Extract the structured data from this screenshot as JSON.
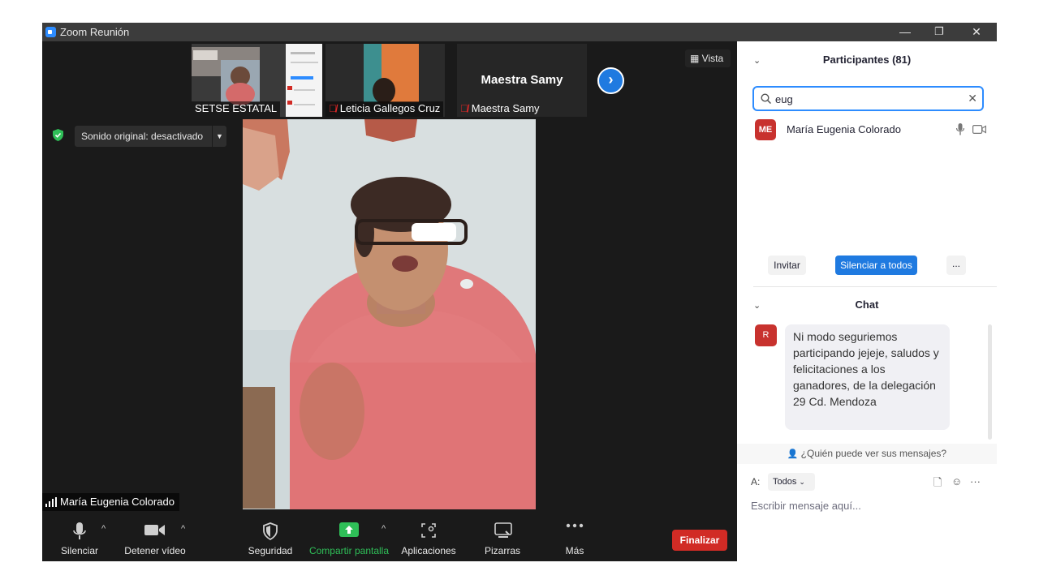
{
  "window": {
    "title": "Zoom Reunión",
    "minimize": "—",
    "restore": "❐",
    "close": "✕"
  },
  "thumbnails": [
    {
      "name": "SETSE ESTATAL",
      "muted": false
    },
    {
      "name": "Leticia Gallegos Cruz",
      "muted": true
    },
    {
      "name": "Maestra Samy",
      "muted": true,
      "display_name": "Maestra Samy"
    }
  ],
  "view_button": "Vista",
  "original_sound": "Sonido original: desactivado",
  "active_speaker": "María Eugenia Colorado",
  "toolbar": {
    "mute": "Silenciar",
    "stop_video": "Detener vídeo",
    "security": "Seguridad",
    "share_screen": "Compartir pantalla",
    "apps": "Aplicaciones",
    "whiteboards": "Pizarras",
    "more": "Más",
    "end": "Finalizar"
  },
  "participants": {
    "title": "Participantes (81)",
    "search_value": "eug",
    "list": [
      {
        "initials": "ME",
        "name": "María Eugenia Colorado"
      }
    ],
    "invite": "Invitar",
    "mute_all": "Silenciar a todos",
    "more": "..."
  },
  "chat": {
    "title": "Chat",
    "messages": [
      {
        "initial": "R",
        "text": "Ni modo seguriemos participando jejeje, saludos y felicitaciones a los ganadores, de la delegación 29 Cd. Mendoza"
      }
    ],
    "who_can_see": "¿Quién puede ver sus mensajes?",
    "to_label": "A:",
    "to_value": "Todos",
    "input_placeholder": "Escribir mensaje aquí..."
  },
  "colors": {
    "accent": "#1f7ae0",
    "end": "#d12b25",
    "share": "#2fbf58",
    "avatar": "#c8322e"
  }
}
